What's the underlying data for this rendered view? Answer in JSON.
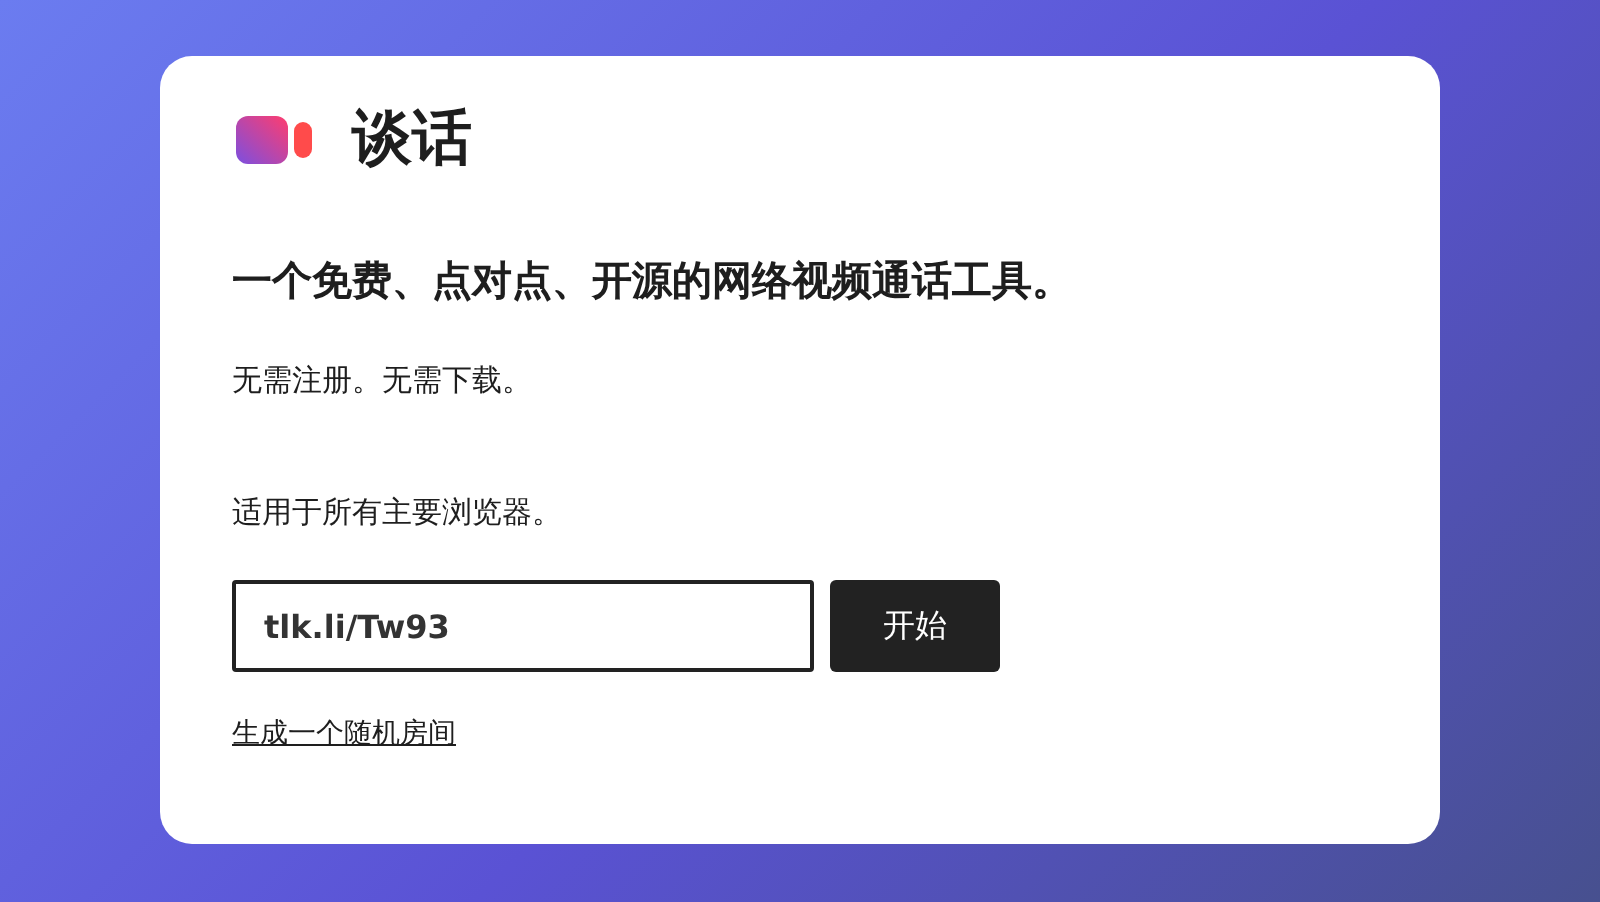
{
  "app": {
    "title": "谈话"
  },
  "headline": "一个免费、点对点、开源的网络视频通话工具。",
  "notes": [
    "无需注册。无需下载。",
    "适用于所有主要浏览器。"
  ],
  "room_field": {
    "value": "tlk.li/Tw93"
  },
  "start_button": {
    "label": "开始"
  },
  "random_room_link": "生成一个随机房间"
}
